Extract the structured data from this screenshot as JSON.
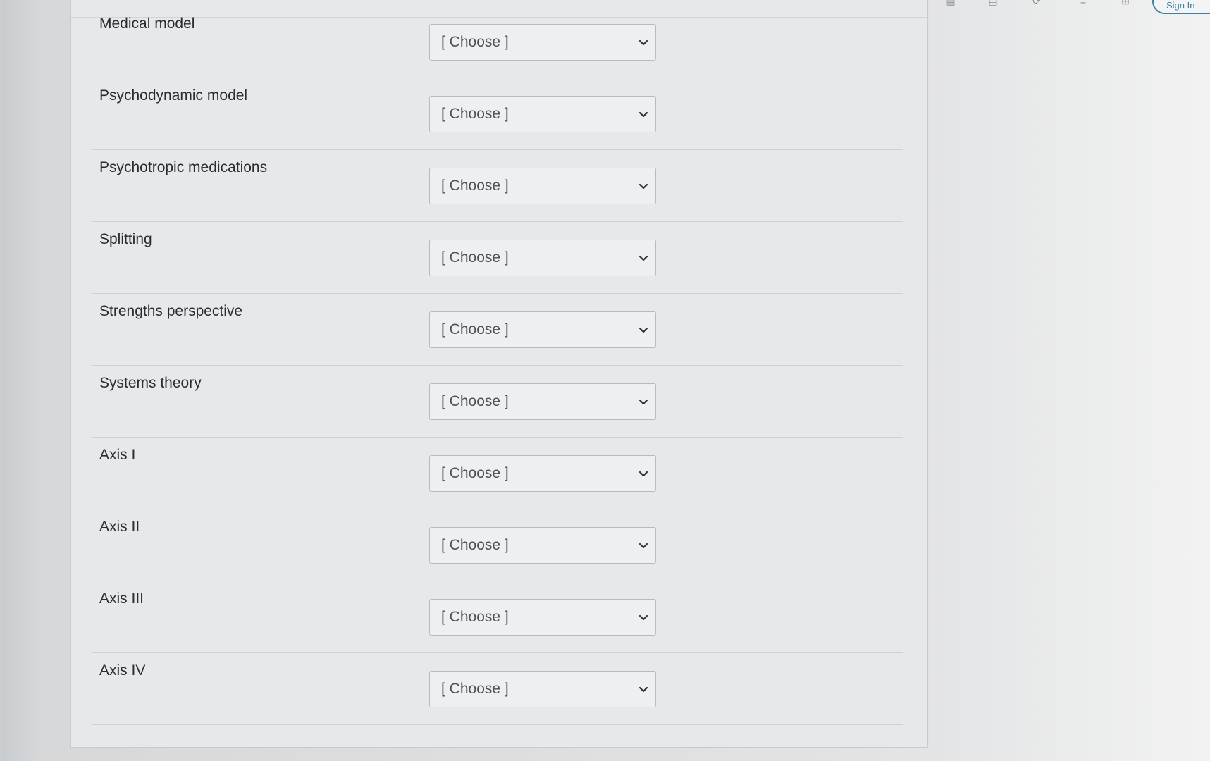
{
  "toolbar": {
    "icons": [
      "refresh-icon",
      "reload-icon",
      "grid-icon",
      "calculator-icon",
      "sync-icon",
      "list-icon",
      "add-icon"
    ],
    "sign_in_label": "Sign In"
  },
  "matching": {
    "items": [
      {
        "label": "Medical model",
        "selected": "[ Choose ]"
      },
      {
        "label": "Psychodynamic model",
        "selected": "[ Choose ]"
      },
      {
        "label": "Psychotropic medications",
        "selected": "[ Choose ]"
      },
      {
        "label": "Splitting",
        "selected": "[ Choose ]"
      },
      {
        "label": "Strengths perspective",
        "selected": "[ Choose ]"
      },
      {
        "label": "Systems theory",
        "selected": "[ Choose ]"
      },
      {
        "label": "Axis I",
        "selected": "[ Choose ]"
      },
      {
        "label": "Axis II",
        "selected": "[ Choose ]"
      },
      {
        "label": "Axis III",
        "selected": "[ Choose ]"
      },
      {
        "label": "Axis IV",
        "selected": "[ Choose ]"
      }
    ]
  }
}
